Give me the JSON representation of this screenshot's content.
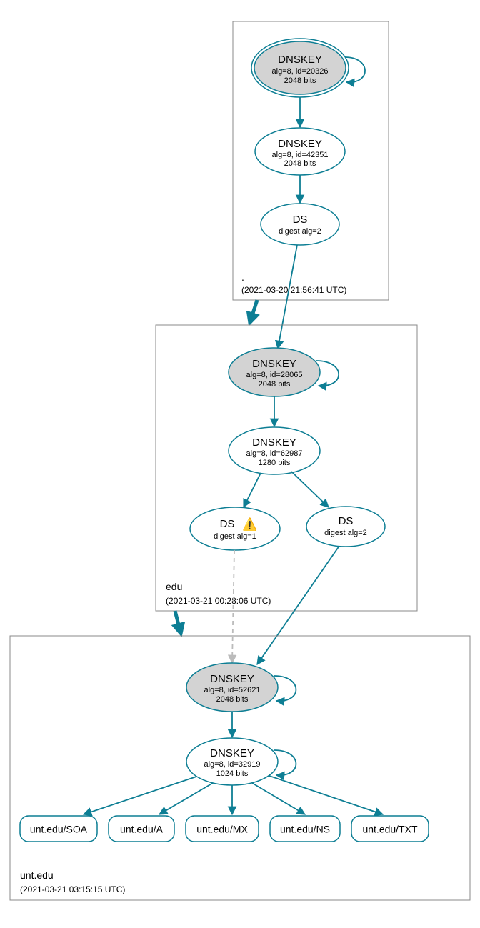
{
  "zones": {
    "root": {
      "label": ".",
      "timestamp": "(2021-03-20 21:56:41 UTC)",
      "dnskey_ksk": {
        "title": "DNSKEY",
        "line1": "alg=8, id=20326",
        "line2": "2048 bits"
      },
      "dnskey_zsk": {
        "title": "DNSKEY",
        "line1": "alg=8, id=42351",
        "line2": "2048 bits"
      },
      "ds": {
        "title": "DS",
        "line1": "digest alg=2"
      }
    },
    "edu": {
      "label": "edu",
      "timestamp": "(2021-03-21 00:28:06 UTC)",
      "dnskey_ksk": {
        "title": "DNSKEY",
        "line1": "alg=8, id=28065",
        "line2": "2048 bits"
      },
      "dnskey_zsk": {
        "title": "DNSKEY",
        "line1": "alg=8, id=62987",
        "line2": "1280 bits"
      },
      "ds_warn": {
        "title": "DS",
        "line1": "digest alg=1"
      },
      "ds": {
        "title": "DS",
        "line1": "digest alg=2"
      }
    },
    "unt": {
      "label": "unt.edu",
      "timestamp": "(2021-03-21 03:15:15 UTC)",
      "dnskey_ksk": {
        "title": "DNSKEY",
        "line1": "alg=8, id=52621",
        "line2": "2048 bits"
      },
      "dnskey_zsk": {
        "title": "DNSKEY",
        "line1": "alg=8, id=32919",
        "line2": "1024 bits"
      },
      "rr": {
        "soa": "unt.edu/SOA",
        "a": "unt.edu/A",
        "mx": "unt.edu/MX",
        "ns": "unt.edu/NS",
        "txt": "unt.edu/TXT"
      }
    }
  },
  "icons": {
    "warn": "⚠️"
  }
}
